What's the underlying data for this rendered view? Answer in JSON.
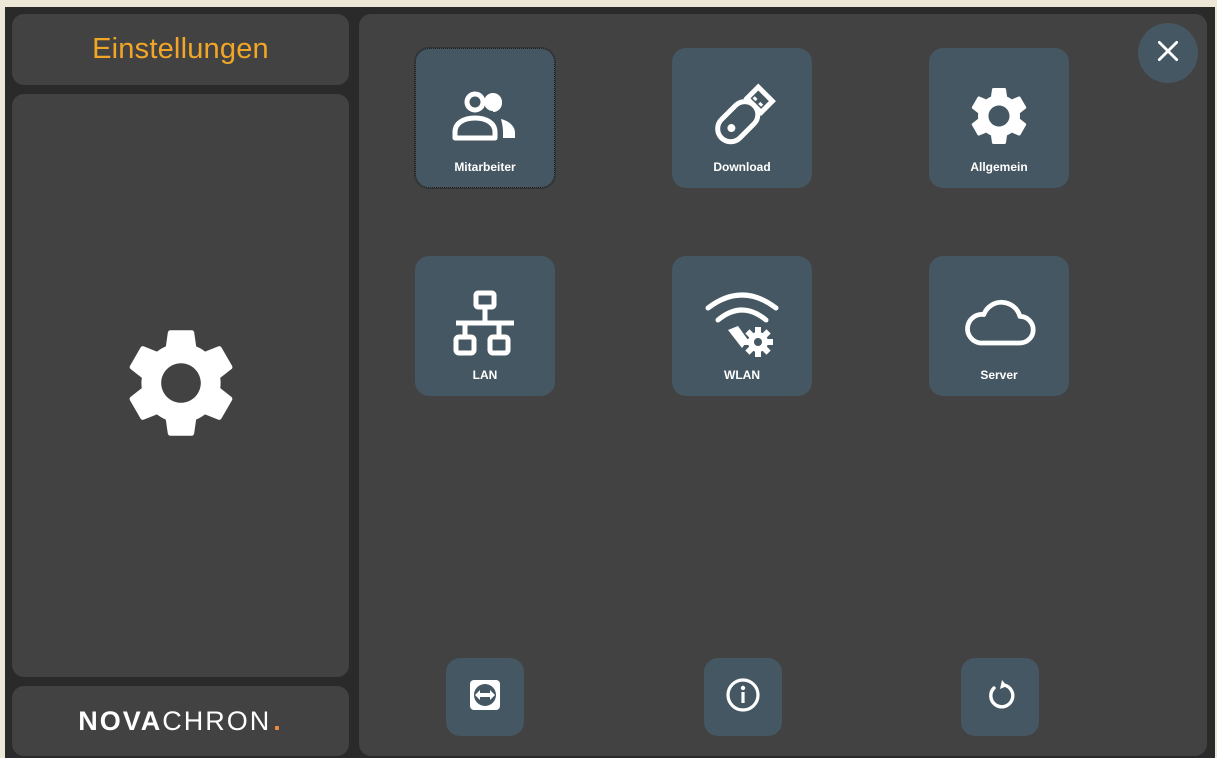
{
  "header": {
    "title": "Einstellungen"
  },
  "sidebar": {
    "icon": "gear-icon"
  },
  "logo": {
    "part1": "NOVA",
    "part2": "CHRON",
    "dot": ".",
    "dot_color": "#f0883c"
  },
  "tiles": [
    {
      "label": "Mitarbeiter",
      "icon": "users-icon"
    },
    {
      "label": "Download",
      "icon": "usb-stick-icon"
    },
    {
      "label": "Allgemein",
      "icon": "gear-icon"
    },
    {
      "label": "LAN",
      "icon": "network-icon"
    },
    {
      "label": "WLAN",
      "icon": "wifi-settings-icon"
    },
    {
      "label": "Server",
      "icon": "cloud-icon"
    }
  ],
  "bottom_buttons": [
    {
      "icon": "teamviewer-icon"
    },
    {
      "icon": "info-icon"
    },
    {
      "icon": "restart-icon"
    }
  ],
  "colors": {
    "accent": "#f2a628",
    "tile": "#455762",
    "panel": "#424242"
  }
}
